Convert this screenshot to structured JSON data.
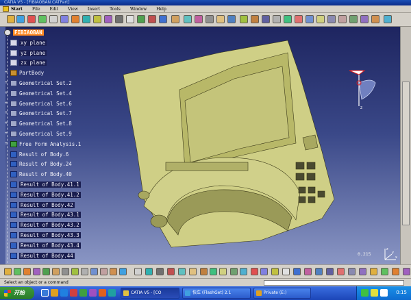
{
  "window": {
    "title": "CATIA V5 - [FIBIAOBAN.CATPart]"
  },
  "menu": {
    "items": [
      {
        "label": "Start",
        "bold": true
      },
      {
        "label": "File"
      },
      {
        "label": "Edit"
      },
      {
        "label": "View"
      },
      {
        "label": "Insert"
      },
      {
        "label": "Tools"
      },
      {
        "label": "Window"
      },
      {
        "label": "Help"
      }
    ]
  },
  "tree": {
    "root": "FIBIAOBAN",
    "items": [
      {
        "label": "xy plane",
        "icon": "plane-icon",
        "hl": true
      },
      {
        "label": "yz plane",
        "icon": "plane-icon",
        "hl": true
      },
      {
        "label": "zx plane",
        "icon": "plane-icon",
        "hl": true
      },
      {
        "label": "PartBody",
        "icon": "partbody-icon",
        "hl": false
      },
      {
        "label": "Geometrical Set.2",
        "icon": "geometrical-set-icon",
        "hl": false
      },
      {
        "label": "Geometrical Set.4",
        "icon": "geometrical-set-icon",
        "hl": false
      },
      {
        "label": "Geometrical Set.6",
        "icon": "geometrical-set-icon",
        "hl": false
      },
      {
        "label": "Geometrical Set.7",
        "icon": "geometrical-set-icon",
        "hl": false
      },
      {
        "label": "Geometrical Set.8",
        "icon": "geometrical-set-icon",
        "hl": false
      },
      {
        "label": "Geometrical Set.9",
        "icon": "geometrical-set-icon",
        "hl": false
      },
      {
        "label": "Free Form Analysis.1",
        "icon": "free-form-analysis-icon",
        "hl": false
      },
      {
        "label": "Result of Body.6",
        "icon": "result-body-icon",
        "hl": false
      },
      {
        "label": "Result of Body.24",
        "icon": "result-body-icon",
        "hl": false
      },
      {
        "label": "Result of Body.40",
        "icon": "result-body-icon",
        "hl": false
      },
      {
        "label": "Result of Body.41.1",
        "icon": "result-body-icon",
        "hl": true
      },
      {
        "label": "Result of Body.41.2",
        "icon": "result-body-icon",
        "hl": true
      },
      {
        "label": "Result of Body.42",
        "icon": "result-body-icon",
        "hl": true
      },
      {
        "label": "Result of Body.43.1",
        "icon": "result-body-icon",
        "hl": true
      },
      {
        "label": "Result of Body.43.2",
        "icon": "result-body-icon",
        "hl": true
      },
      {
        "label": "Result of Body.43.3",
        "icon": "result-body-icon",
        "hl": true
      },
      {
        "label": "Result of Body.43.4",
        "icon": "result-body-icon",
        "hl": true
      },
      {
        "label": "Result of Body.44",
        "icon": "result-body-icon",
        "hl": true
      }
    ]
  },
  "viewport": {
    "zoom_readout": "0.215"
  },
  "compass": {
    "x_label": "x",
    "y_label": "y",
    "z_label": "z"
  },
  "axis": {
    "x_label": "x",
    "y_label": "y",
    "z_label": "z"
  },
  "status": {
    "prompt": "Select an object or a command"
  },
  "taskbar": {
    "start_label": "开始",
    "tasks": [
      {
        "label": "CATIA V5 - [CO",
        "active": true
      },
      {
        "label": "快车 (FlashGet) 2.1",
        "active": false
      },
      {
        "label": "Private (E:)",
        "active": false
      }
    ],
    "clock": "0:15"
  },
  "colors": {
    "viewport_top": "#1e2560",
    "viewport_bottom": "#8a96c4",
    "tree_root_highlight": "#ff8820",
    "part_surface": "#d8d890"
  }
}
